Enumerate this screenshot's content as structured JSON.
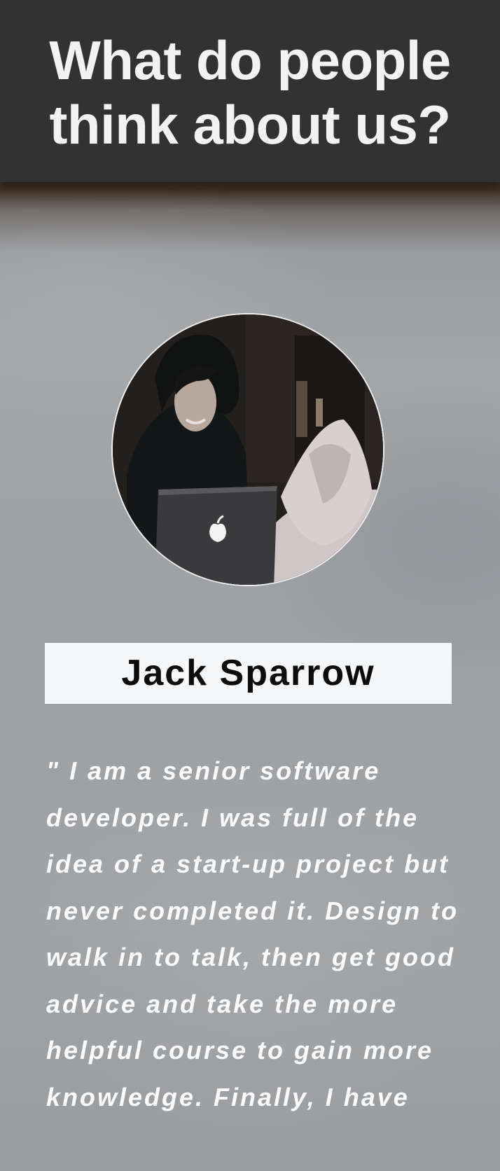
{
  "header": {
    "title": "What do people think about us?"
  },
  "testimonial": {
    "avatar_alt": "Person smiling at a laptop",
    "name": "Jack Sparrow",
    "quote": "\" I am a senior software developer. I was full of the idea of a start-up project but never completed it. Design to walk in to talk, then get good advice and take the more helpful course to gain more knowledge. Finally, I have"
  },
  "colors": {
    "header_bg": "#333233",
    "header_text": "#f2f2f2",
    "name_box_bg": "#f6f7f9",
    "name_text": "#0c0c0c",
    "quote_text": "#fbfbfb"
  }
}
